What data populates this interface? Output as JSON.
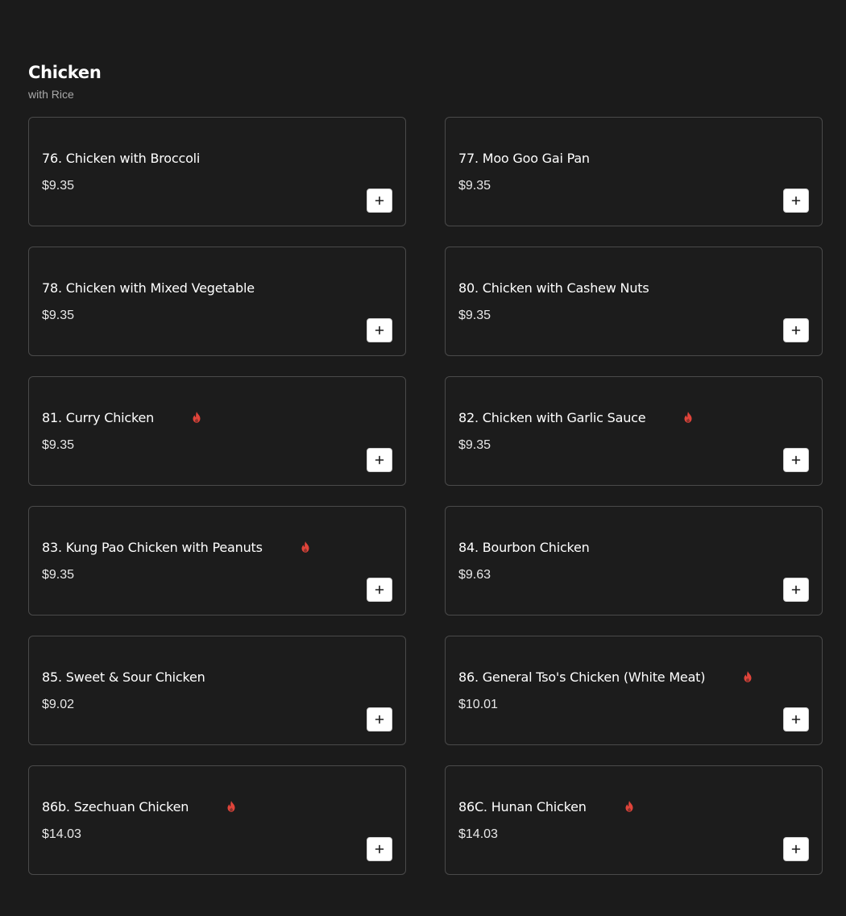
{
  "section": {
    "title": "Chicken",
    "subtitle": "with Rice"
  },
  "colors": {
    "background": "#1b1b1b",
    "card_border": "#4a4a4a",
    "spicy": "#e0443a",
    "button_bg": "#ffffff"
  },
  "items": [
    {
      "name": "76. Chicken with Broccoli",
      "price": "$9.35",
      "spicy": false
    },
    {
      "name": "77. Moo Goo Gai Pan",
      "price": "$9.35",
      "spicy": false
    },
    {
      "name": "78. Chicken with Mixed Vegetable",
      "price": "$9.35",
      "spicy": false
    },
    {
      "name": "80. Chicken with Cashew Nuts",
      "price": "$9.35",
      "spicy": false
    },
    {
      "name": "81. Curry Chicken",
      "price": "$9.35",
      "spicy": true
    },
    {
      "name": "82. Chicken with Garlic Sauce",
      "price": "$9.35",
      "spicy": true
    },
    {
      "name": "83. Kung Pao Chicken with Peanuts",
      "price": "$9.35",
      "spicy": true
    },
    {
      "name": "84. Bourbon Chicken",
      "price": "$9.63",
      "spicy": false
    },
    {
      "name": "85. Sweet & Sour Chicken",
      "price": "$9.02",
      "spicy": false
    },
    {
      "name": "86. General Tso's Chicken (White Meat)",
      "price": "$10.01",
      "spicy": true
    },
    {
      "name": "86b. Szechuan Chicken",
      "price": "$14.03",
      "spicy": true
    },
    {
      "name": "86C. Hunan Chicken",
      "price": "$14.03",
      "spicy": true
    }
  ],
  "icons": {
    "spicy": "flame-icon",
    "add": "plus-icon"
  }
}
